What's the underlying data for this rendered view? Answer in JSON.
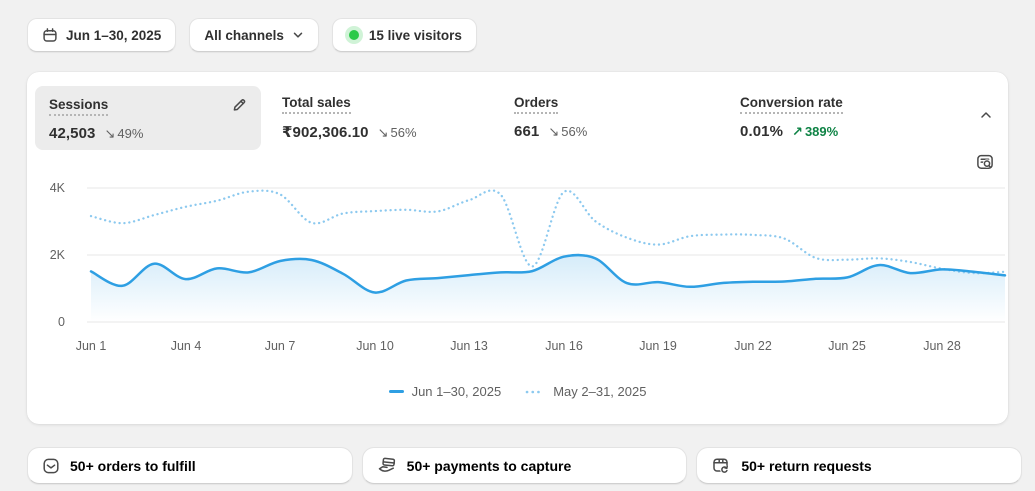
{
  "topbar": {
    "date_range": "Jun 1–30, 2025",
    "channels": "All channels",
    "live_visitors": "15 live visitors"
  },
  "metrics": [
    {
      "label": "Sessions",
      "value": "42,503",
      "arrow": "↘",
      "change": "49%",
      "direction": "down",
      "selected": true
    },
    {
      "label": "Total sales",
      "value": "₹902,306.10",
      "arrow": "↘",
      "change": "56%",
      "direction": "down",
      "selected": false
    },
    {
      "label": "Orders",
      "value": "661",
      "arrow": "↘",
      "change": "56%",
      "direction": "down",
      "selected": false
    },
    {
      "label": "Conversion rate",
      "value": "0.01%",
      "arrow": "↗",
      "change": "389%",
      "direction": "up",
      "selected": false
    }
  ],
  "chart_data": {
    "type": "line",
    "metric": "Sessions",
    "title": "",
    "xlabel": "",
    "ylabel": "",
    "ylim": [
      0,
      4300
    ],
    "grid": "horizontal",
    "legend_position": "bottom",
    "y_tick_labels": [
      "4K",
      "2K",
      "0"
    ],
    "x_tick_labels": [
      "Jun 1",
      "Jun 4",
      "Jun 7",
      "Jun 10",
      "Jun 13",
      "Jun 16",
      "Jun 19",
      "Jun 22",
      "Jun 25",
      "Jun 28"
    ],
    "categories": [
      "Jun 1",
      "Jun 2",
      "Jun 3",
      "Jun 4",
      "Jun 5",
      "Jun 6",
      "Jun 7",
      "Jun 8",
      "Jun 9",
      "Jun 10",
      "Jun 11",
      "Jun 12",
      "Jun 13",
      "Jun 14",
      "Jun 15",
      "Jun 16",
      "Jun 17",
      "Jun 18",
      "Jun 19",
      "Jun 20",
      "Jun 21",
      "Jun 22",
      "Jun 23",
      "Jun 24",
      "Jun 25",
      "Jun 26",
      "Jun 27",
      "Jun 28",
      "Jun 29",
      "Jun 30"
    ],
    "series": [
      {
        "name": "Jun 1–30, 2025",
        "style": "solid",
        "color": "#2e9fe3",
        "values": [
          1510,
          1080,
          1740,
          1280,
          1600,
          1480,
          1820,
          1850,
          1440,
          880,
          1240,
          1310,
          1400,
          1480,
          1520,
          1950,
          1900,
          1160,
          1190,
          1050,
          1160,
          1200,
          1210,
          1290,
          1330,
          1700,
          1460,
          1570,
          1500,
          1390
        ]
      },
      {
        "name": "May 2–31, 2025",
        "style": "dotted",
        "color": "#8cc9ef",
        "values": [
          3160,
          2950,
          3190,
          3440,
          3620,
          3890,
          3810,
          2960,
          3240,
          3310,
          3350,
          3300,
          3640,
          3800,
          1660,
          3880,
          3010,
          2520,
          2310,
          2560,
          2610,
          2600,
          2490,
          1910,
          1860,
          1900,
          1790,
          1590,
          1460,
          1500
        ]
      }
    ]
  },
  "footer": {
    "buttons": [
      {
        "label": "50+ orders to fulfill",
        "icon": "inbox-icon"
      },
      {
        "label": "50+ payments to capture",
        "icon": "card-hand-icon"
      },
      {
        "label": "50+ return requests",
        "icon": "return-box-icon"
      }
    ]
  },
  "icons": {
    "date_picker": "calendar-icon",
    "channels_expand": "chevron-down-icon",
    "live_indicator": "green-dot",
    "metric_edit": "pencil-icon",
    "collapse_chart": "chevron-up-icon",
    "explore_data": "search-data-icon"
  },
  "colors": {
    "accent_line": "#2e9fe3",
    "comparison_line": "#8cc9ef",
    "success_green": "#0e8345",
    "live_dot": "#2bc948",
    "text_primary": "#303030",
    "text_secondary": "#616161",
    "page_bg": "#f1f1f1",
    "card_bg": "#ffffff",
    "selected_metric_bg": "#ececec",
    "gridline": "#e7e7e7"
  }
}
